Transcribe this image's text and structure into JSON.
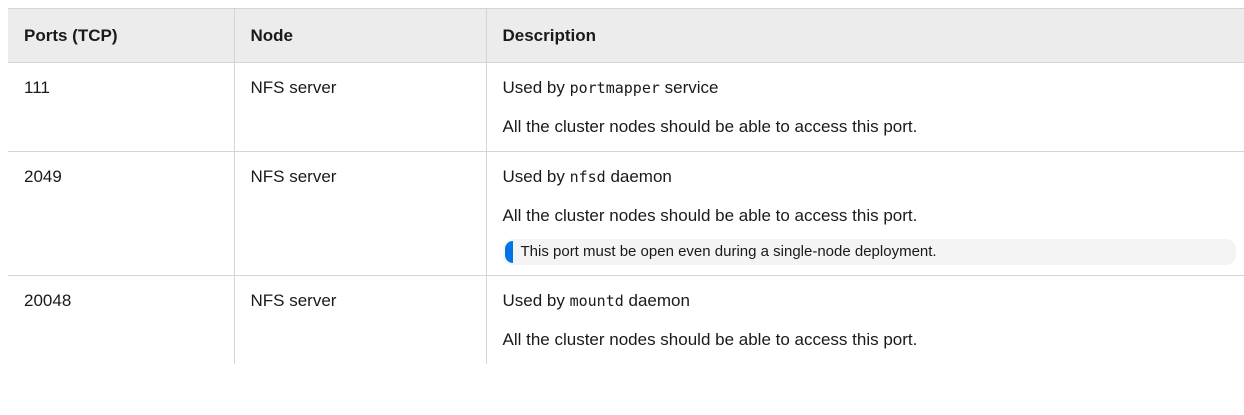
{
  "table": {
    "headers": [
      "Ports (TCP)",
      "Node",
      "Description"
    ],
    "rows": [
      {
        "port": "111",
        "node": "NFS server",
        "desc_prefix": "Used by ",
        "desc_code": "portmapper",
        "desc_suffix": " service",
        "desc_access": "All the cluster nodes should be able to access this port."
      },
      {
        "port": "2049",
        "node": "NFS server",
        "desc_prefix": "Used by ",
        "desc_code": "nfsd",
        "desc_suffix": " daemon",
        "desc_access": "All the cluster nodes should be able to access this port.",
        "note": "This port must be open even during a single-node deployment."
      },
      {
        "port": "20048",
        "node": "NFS server",
        "desc_prefix": "Used by ",
        "desc_code": "mountd",
        "desc_suffix": " daemon",
        "desc_access": "All the cluster nodes should be able to access this port."
      }
    ]
  },
  "colors": {
    "header_bg": "#ececec",
    "note_bg": "#f4f4f4",
    "note_accent": "#0073e6",
    "border": "#d4d4d4"
  }
}
